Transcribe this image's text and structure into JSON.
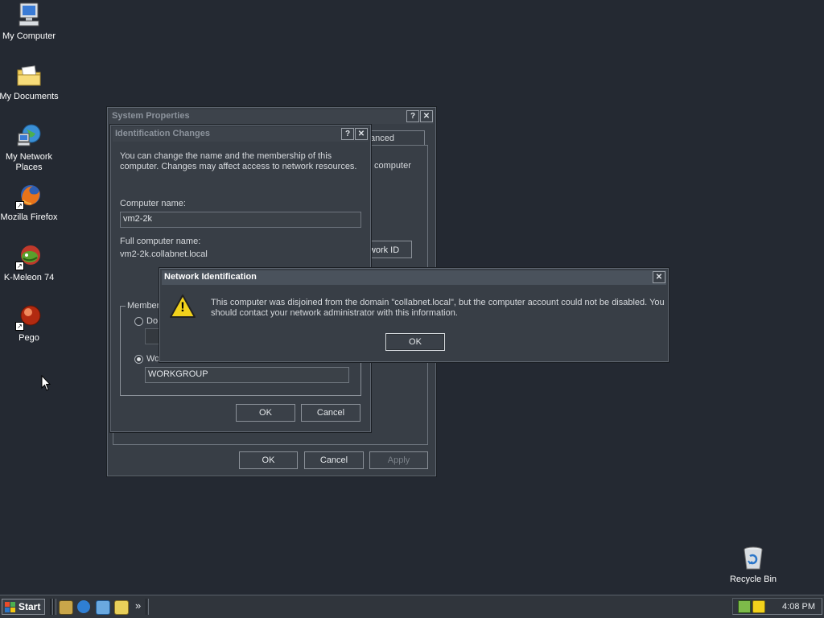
{
  "desktop": {
    "icons": [
      {
        "label_line1": "My Computer",
        "label_line2": ""
      },
      {
        "label_line1": "My Documents",
        "label_line2": ""
      },
      {
        "label_line1": "My Network",
        "label_line2": "Places"
      },
      {
        "label_line1": "Mozilla Firefox",
        "label_line2": ""
      },
      {
        "label_line1": "K-Meleon 74",
        "label_line2": ""
      },
      {
        "label_line1": "Pego",
        "label_line2": ""
      }
    ],
    "recycle_bin": "Recycle Bin",
    "shortcut_glyph": "↗"
  },
  "system_properties": {
    "title": "System Properties",
    "help_glyph": "?",
    "close_glyph": "✕",
    "tab_partial": "anced",
    "text_partial": "computer",
    "network_id_partial": "twork ID",
    "ok": "OK",
    "cancel": "Cancel",
    "apply": "Apply"
  },
  "identification_changes": {
    "title": "Identification Changes",
    "help_glyph": "?",
    "close_glyph": "✕",
    "intro_line1": "You can change the name and the membership of this",
    "intro_line2": "computer. Changes may affect access to network resources.",
    "computer_name_label": "Computer name:",
    "computer_name_value": "vm2-2k",
    "full_name_label": "Full computer name:",
    "full_name_value": "vm2-2k.collabnet.local",
    "member_of_partial": "Member",
    "domain_partial": "Do",
    "workgroup_partial": "Wo",
    "workgroup_value": "WORKGROUP",
    "ok": "OK",
    "cancel": "Cancel"
  },
  "network_identification": {
    "title": "Network Identification",
    "close_glyph": "✕",
    "warning_icon": "warning-icon",
    "warning_glyph": "!",
    "message_line1": "This computer was disjoined from the domain \"collabnet.local\", but the computer account could not be disabled.  You",
    "message_line2": "should contact your network administrator with this information.",
    "ok": "OK"
  },
  "taskbar": {
    "start_label": "Start",
    "chevron": "»",
    "clock": "4:08 PM"
  },
  "colors": {
    "desktop": "#242932",
    "window": "#383e46",
    "active_title": "#4a525c",
    "warning_yellow": "#f2d21c"
  }
}
